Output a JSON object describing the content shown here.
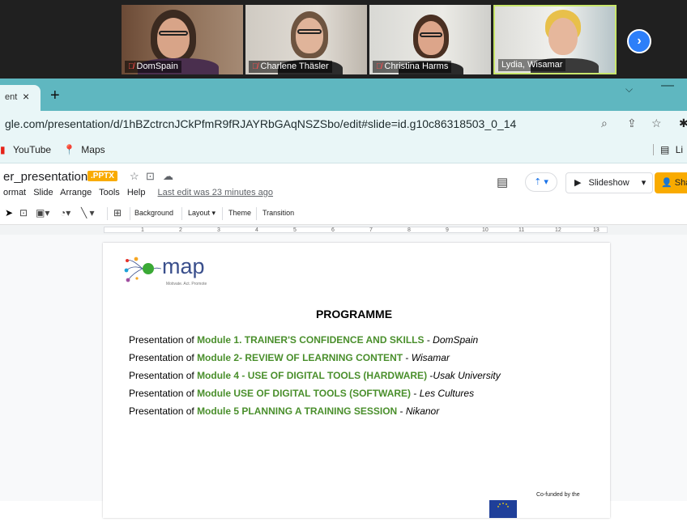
{
  "meeting": {
    "participants": [
      {
        "name": "DomSpain",
        "muted": true
      },
      {
        "name": "Charlene Thäsler",
        "muted": true
      },
      {
        "name": "Christina Harms",
        "muted": true
      },
      {
        "name": "Lydia, Wisamar",
        "muted": false
      }
    ],
    "next_icon": "chevron-right-icon"
  },
  "browser": {
    "tab": {
      "title": "ent",
      "close": "×"
    },
    "new_tab": "+",
    "tab_list": "⌵",
    "minimize": "—",
    "url": "gle.com/presentation/d/1hBZctrcnJCkPfmR9fRJAYRbGAqNSZSbo/edit#slide=id.g10c86318503_0_14",
    "bookmarks": [
      {
        "label": "YouTube",
        "icon": "youtube-icon"
      },
      {
        "label": "Maps",
        "icon": "maps-icon"
      }
    ],
    "bookmarks_right": "Li"
  },
  "slides_app": {
    "doc_title": "er_presentation",
    "format_badge": ".PPTX",
    "menus": [
      "ormat",
      "Slide",
      "Arrange",
      "Tools",
      "Help"
    ],
    "last_edit": "Last edit was 23 minutes ago",
    "slideshow_label": "Slideshow",
    "share_label": "Sha",
    "toolbar": {
      "background": "Background",
      "layout": "Layout",
      "theme": "Theme",
      "transition": "Transition"
    },
    "ruler_numbers": [
      "1",
      "2",
      "3",
      "4",
      "5",
      "6",
      "7",
      "8",
      "9",
      "10",
      "11",
      "12",
      "13"
    ]
  },
  "slide": {
    "logo_word": "map",
    "logo_tagline": "Motivate. Act. Promote",
    "title": "PROGRAMME",
    "lines": [
      {
        "prefix": "Presentation of ",
        "module": "Module 1. TRAINER'S CONFIDENCE AND SKILLS",
        "sep": " - ",
        "partner": "DomSpain"
      },
      {
        "prefix": "Presentation of  ",
        "module": "Module 2- REVIEW OF LEARNING CONTENT",
        "sep": "  - ",
        "partner": "Wisamar"
      },
      {
        "prefix": "Presentation of  ",
        "module": "Module 4 -  USE OF DIGITAL TOOLS (HARDWARE)",
        "sep": " -",
        "partner": "Usak University"
      },
      {
        "prefix": "Presentation of ",
        "module": "Module USE OF DIGITAL TOOLS (SOFTWARE)",
        "sep": " - ",
        "partner": "Les Cultures"
      },
      {
        "prefix": "Presentation of ",
        "module": "Module 5 PLANNING A TRAINING SESSION",
        "sep": " - ",
        "partner": "Nikanor"
      }
    ],
    "cofunded": "Co-funded by the"
  },
  "colors": {
    "tab_bar": "#5fb7c0",
    "chrome_light": "#e9f6f7",
    "module_green": "#4a8f2c",
    "share_yellow": "#f9ab00",
    "logo_blue": "#3a4f8c"
  }
}
